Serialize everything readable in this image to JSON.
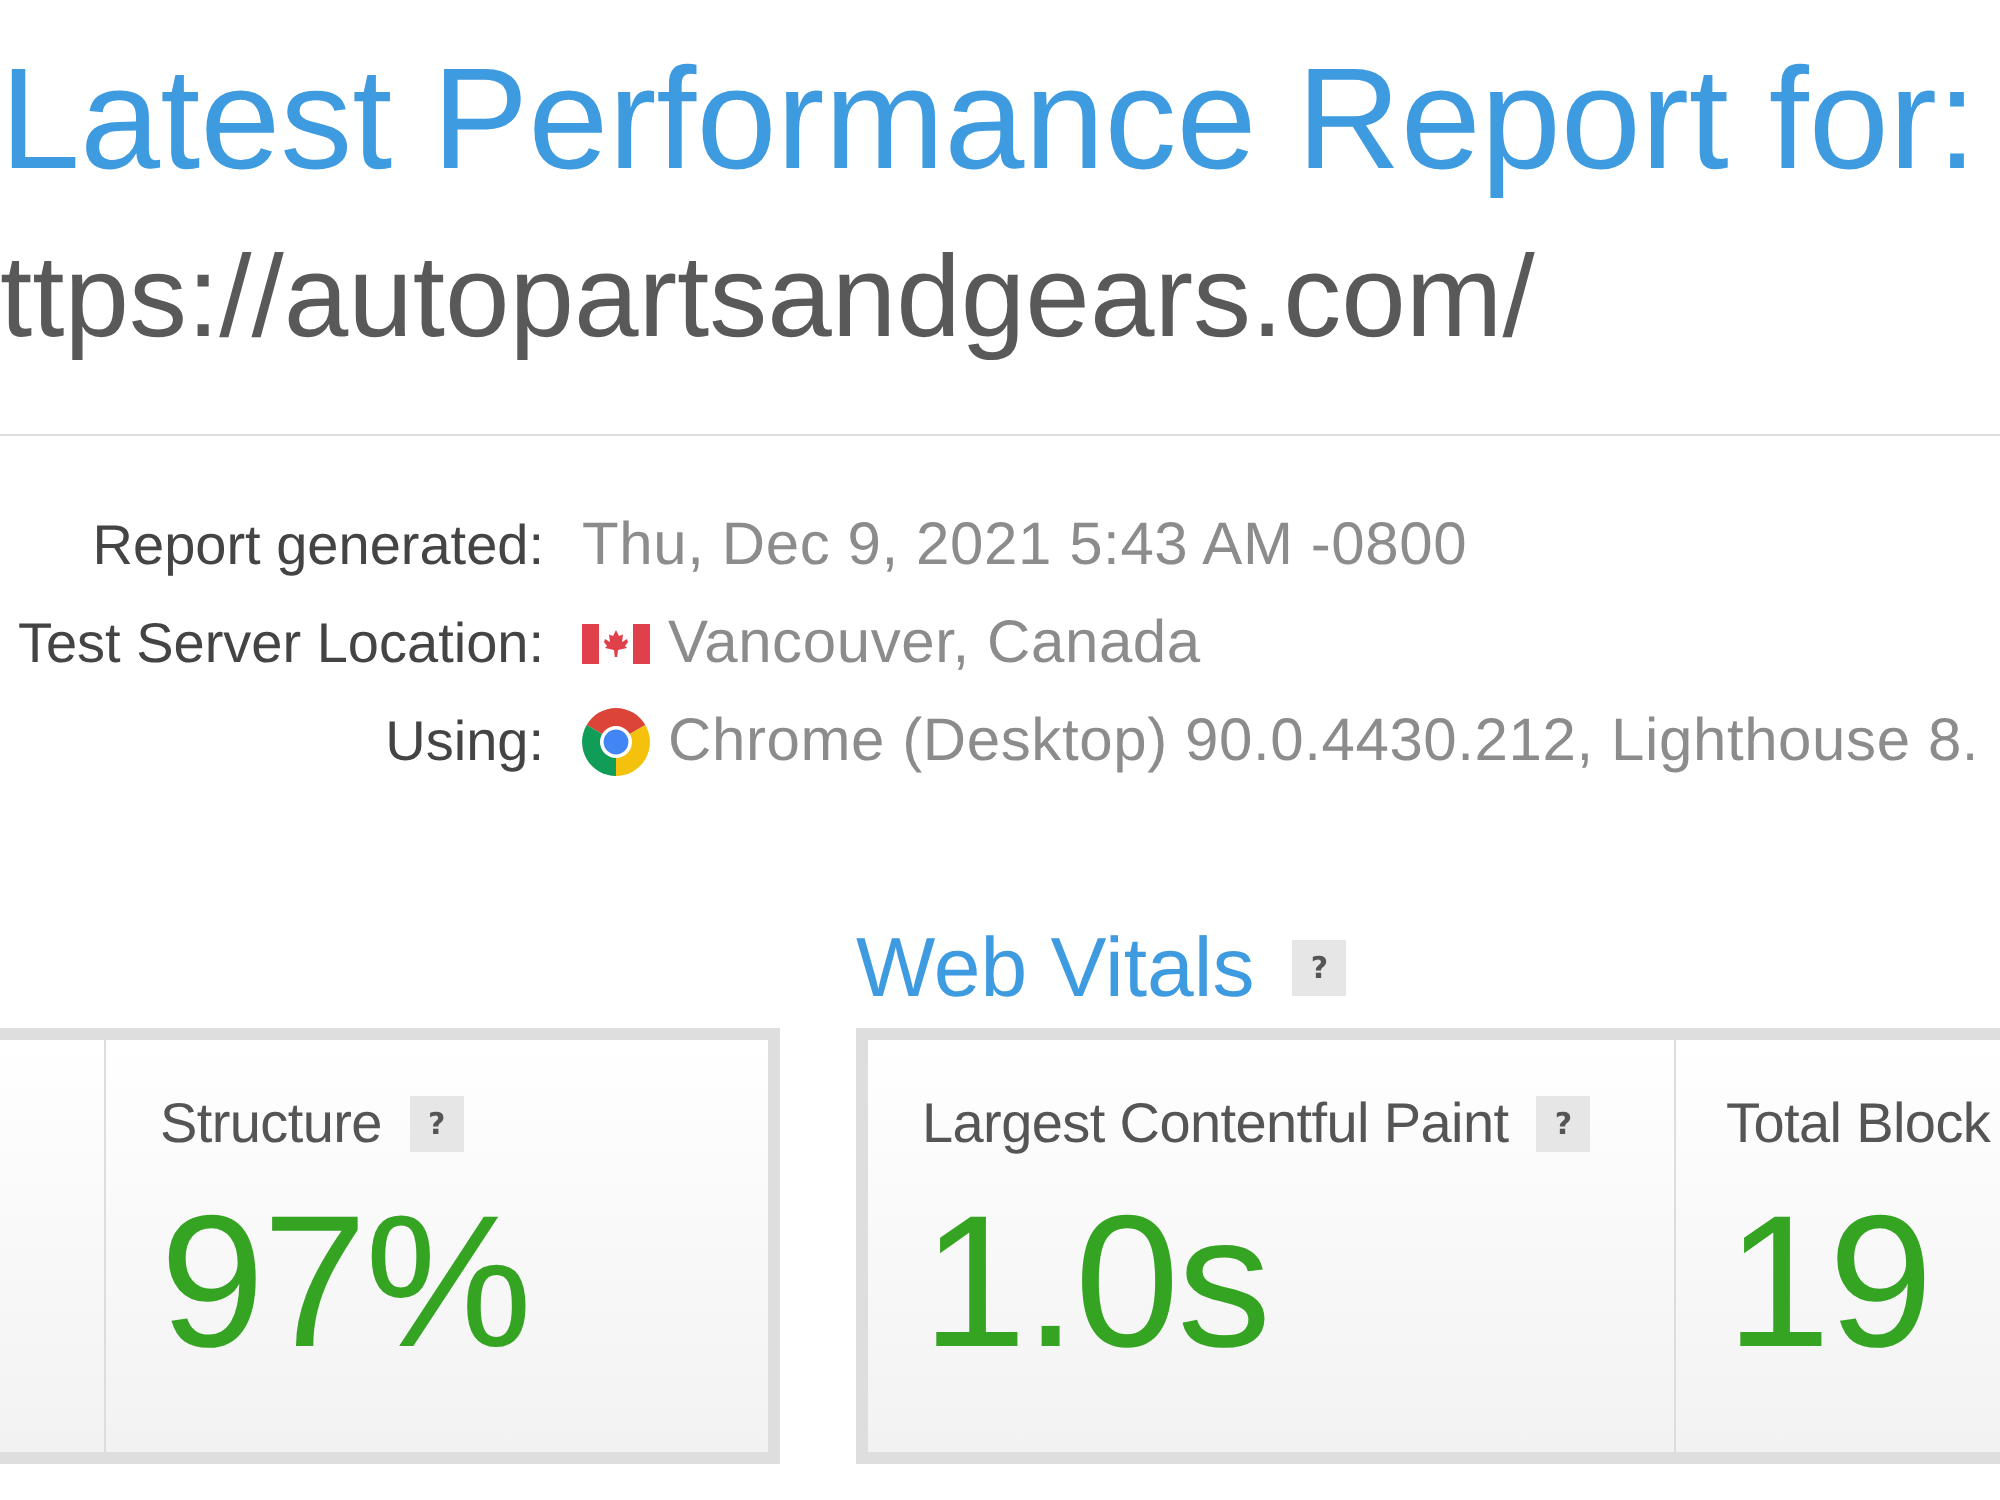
{
  "report": {
    "title": "Latest Performance Report for:",
    "url": "ttps://autopartsandgears.com/"
  },
  "details": [
    {
      "kind": "plain",
      "label": "Report generated:",
      "value": "Thu, Dec 9, 2021 5:43 AM -0800"
    },
    {
      "kind": "location",
      "label": "Test Server Location:",
      "value": "Vancouver, Canada"
    },
    {
      "kind": "browser",
      "label": "Using:",
      "value": "Chrome (Desktop) 90.0.4430.212, Lighthouse 8."
    }
  ],
  "grade": {
    "metrics": [
      {
        "label": "Structure",
        "help": "?",
        "value": "97%"
      }
    ]
  },
  "web_vitals": {
    "title": "Web Vitals",
    "help": "?",
    "metrics": [
      {
        "label": "Largest Contentful Paint",
        "help": "?",
        "value": "1.0s"
      },
      {
        "label": "Total Block",
        "value": "19"
      }
    ]
  }
}
